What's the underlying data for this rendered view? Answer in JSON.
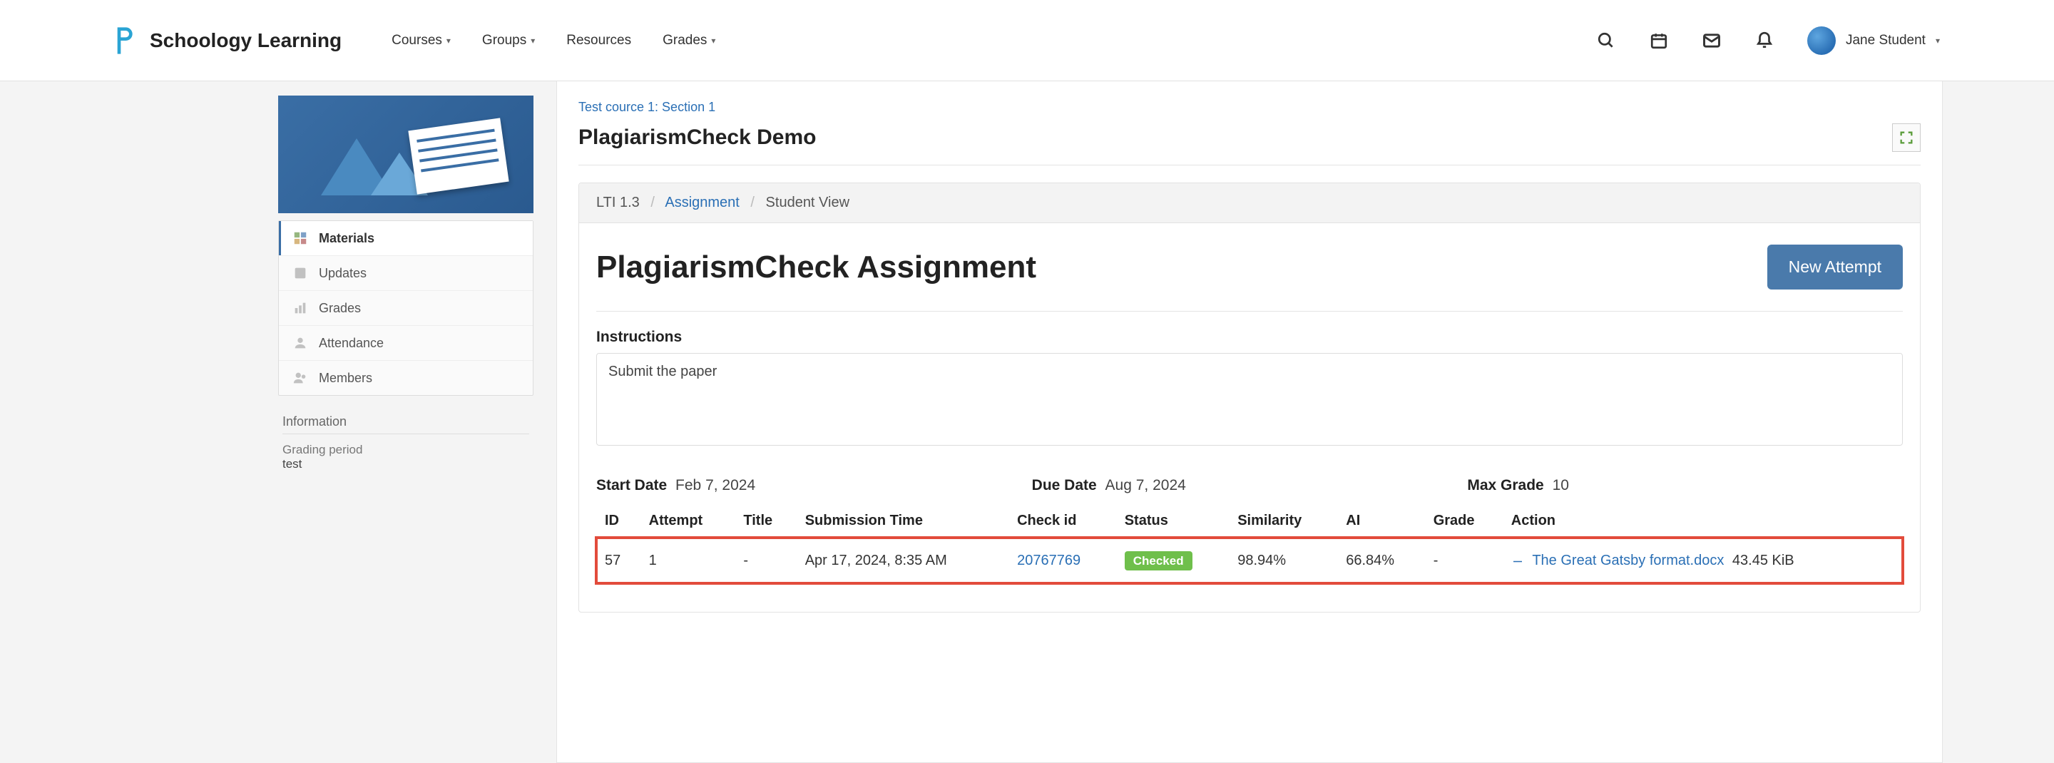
{
  "header": {
    "brand": "Schoology Learning",
    "nav": [
      {
        "label": "Courses",
        "has_dropdown": true
      },
      {
        "label": "Groups",
        "has_dropdown": true
      },
      {
        "label": "Resources",
        "has_dropdown": false
      },
      {
        "label": "Grades",
        "has_dropdown": true
      }
    ],
    "user_name": "Jane Student"
  },
  "sidebar": {
    "items": [
      {
        "label": "Materials",
        "icon": "materials-icon",
        "active": true
      },
      {
        "label": "Updates",
        "icon": "updates-icon",
        "active": false
      },
      {
        "label": "Grades",
        "icon": "grades-icon",
        "active": false
      },
      {
        "label": "Attendance",
        "icon": "attendance-icon",
        "active": false
      },
      {
        "label": "Members",
        "icon": "members-icon",
        "active": false
      }
    ],
    "info_heading": "Information",
    "info_key": "Grading period",
    "info_value": "test"
  },
  "main": {
    "breadcrumb_parent": "Test cource 1: Section 1",
    "title": "PlagiarismCheck Demo",
    "inner_breadcrumb": {
      "a": "LTI 1.3",
      "b": "Assignment",
      "c": "Student View"
    },
    "tool_title": "PlagiarismCheck Assignment",
    "new_attempt_label": "New Attempt",
    "instructions_label": "Instructions",
    "instructions_text": "Submit the paper",
    "meta": {
      "start_key": "Start Date",
      "start_val": "Feb 7, 2024",
      "due_key": "Due Date",
      "due_val": "Aug 7, 2024",
      "max_key": "Max Grade",
      "max_val": "10"
    },
    "columns": {
      "id": "ID",
      "attempt": "Attempt",
      "title": "Title",
      "submission_time": "Submission Time",
      "check_id": "Check id",
      "status": "Status",
      "similarity": "Similarity",
      "ai": "AI",
      "grade": "Grade",
      "action": "Action"
    },
    "row": {
      "id": "57",
      "attempt": "1",
      "title": "-",
      "submission_time": "Apr 17, 2024, 8:35 AM",
      "check_id": "20767769",
      "status": "Checked",
      "similarity": "98.94%",
      "ai": "66.84%",
      "grade": "-",
      "file_name": "The Great Gatsby format.docx",
      "file_size": "43.45 KiB"
    }
  }
}
